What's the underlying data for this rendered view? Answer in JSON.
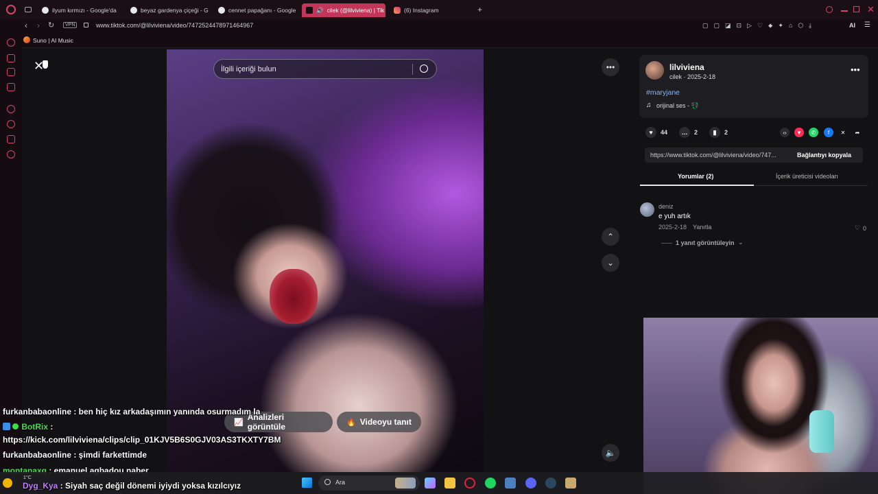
{
  "browser": {
    "tabs": [
      {
        "label": "ilyum kırmızı - Google'da"
      },
      {
        "label": "beyaz gardenya çiçeği - G"
      },
      {
        "label": "cennet papağanı - Google"
      },
      {
        "label": "cilek (@lilviviena) | Tik"
      },
      {
        "label": "(6) Instagram"
      }
    ],
    "new_tab": "+",
    "vpn_label": "VPN",
    "url": "www.tiktok.com/@lilviviena/video/7472524478971464967",
    "ai_label": "AI",
    "bookmark": "Suno | AI Music",
    "accent": "#d5466c"
  },
  "video": {
    "search_placeholder": "İlgili içeriği bulun",
    "analytics_button": "Analizleri görüntüle",
    "promote_button": "Videoyu tanıt"
  },
  "post": {
    "username": "lilviviena",
    "meta": "cilek · 2025-2-18",
    "hashtag": "#maryjane",
    "sound": "orijinal ses - 💱",
    "likes": "44",
    "comments": "2",
    "saves": "2",
    "link": "https://www.tiktok.com/@lilviviena/video/747...",
    "copy_link": "Bağlantıyı kopyala",
    "tab_comments": "Yorumlar (2)",
    "tab_creator": "İçerik üreticisi videoları"
  },
  "comment": {
    "author": "deniz",
    "text": "e yuh artık",
    "date": "2025-2-18",
    "reply": "Yanıtla",
    "likes": "0",
    "view_replies": "1 yanıt görüntüleyin"
  },
  "chat": [
    {
      "user": "furkanbabaonline",
      "msg": " : ben hiç kız arkadaşımın yanında osurmadım la",
      "color": "#ffffff"
    },
    {
      "user": "BotRix",
      "msg": " :",
      "color": "#3ee04a"
    },
    {
      "user": "",
      "msg": "https://kick.com/lilviviena/clips/clip_01KJV5B6S0GJV03AS3TKXTY7BM",
      "color": "#ffffff"
    },
    {
      "user": "furkanbabaonline",
      "msg": " : şimdi farkettimde",
      "color": "#ffffff"
    },
    {
      "user": "montanaxq",
      "msg": " : emanuel agbadou naber",
      "color": "#3ee04a"
    },
    {
      "user": "Dyg_Kya",
      "msg": " : Siyah saç değil dönemi iyiydi yoksa kızılcıyız",
      "color": "#c77dff"
    }
  ],
  "taskbar": {
    "search": "Ara",
    "temp": "1°C"
  }
}
